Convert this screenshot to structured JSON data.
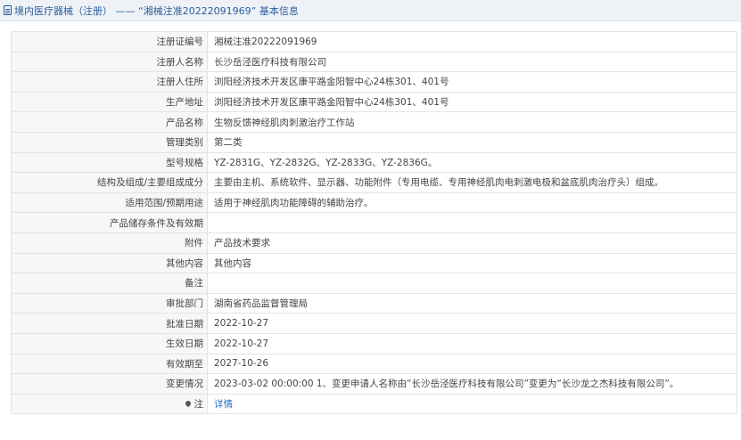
{
  "header": {
    "title": "境内医疗器械（注册） —— “湘械注准20222091969” 基本信息"
  },
  "rows": [
    {
      "label": "注册证编号",
      "value": "湘械注准20222091969"
    },
    {
      "label": "注册人名称",
      "value": "长沙岳泾医疗科技有限公司"
    },
    {
      "label": "注册人住所",
      "value": "浏阳经济技术开发区康平路金阳智中心24栋301、401号"
    },
    {
      "label": "生产地址",
      "value": "浏阳经济技术开发区康平路金阳智中心24栋301、401号"
    },
    {
      "label": "产品名称",
      "value": "生物反馈神经肌肉刺激治疗工作站"
    },
    {
      "label": "管理类别",
      "value": "第二类"
    },
    {
      "label": "型号规格",
      "value": "YZ-2831G、YZ-2832G、YZ-2833G、YZ-2836G。"
    },
    {
      "label": "结构及组成/主要组成成分",
      "value": "主要由主机、系统软件、显示器、功能附件（专用电缆、专用神经肌肉电刺激电极和盆底肌肉治疗头）组成。"
    },
    {
      "label": "适用范围/预期用途",
      "value": "适用于神经肌肉功能障碍的辅助治疗。"
    },
    {
      "label": "产品储存条件及有效期",
      "value": ""
    },
    {
      "label": "附件",
      "value": "产品技术要求"
    },
    {
      "label": "其他内容",
      "value": "其他内容"
    },
    {
      "label": "备注",
      "value": ""
    },
    {
      "label": "审批部门",
      "value": "湖南省药品监督管理局"
    },
    {
      "label": "批准日期",
      "value": "2022-10-27"
    },
    {
      "label": "生效日期",
      "value": "2022-10-27"
    },
    {
      "label": "有效期至",
      "value": "2027-10-26"
    },
    {
      "label": "变更情况",
      "value": "2023-03-02 00:00:00 1、变更申请人名称由“长沙岳泾医疗科技有限公司”变更为“长沙龙之杰科技有限公司”。"
    }
  ],
  "footer_row": {
    "icon": "location-pin-icon",
    "label": "注",
    "link_text": "详情"
  },
  "colors": {
    "header_bg": "#eef2f7",
    "header_text": "#2a5c9a",
    "label_bg": "#f7f7f7",
    "border": "#e3e3e3",
    "link": "#2a6fc9"
  }
}
